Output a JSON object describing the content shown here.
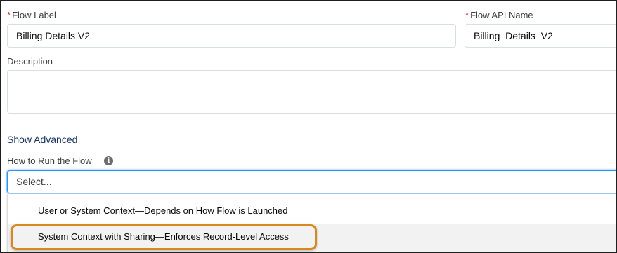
{
  "form": {
    "required_marker": "*",
    "flow_label": {
      "label": "Flow Label",
      "value": "Billing Details V2"
    },
    "flow_api_name": {
      "label": "Flow API Name",
      "value": "Billing_Details_V2"
    },
    "description": {
      "label": "Description",
      "value": ""
    },
    "show_advanced_label": "Show Advanced",
    "how_to_run": {
      "label": "How to Run the Flow",
      "info_icon": "info-icon",
      "placeholder": "Select...",
      "options": [
        {
          "label": "User or System Context—Depends on How Flow is Launched",
          "highlighted": false
        },
        {
          "label": "System Context with Sharing—Enforces Record-Level Access",
          "highlighted": true
        }
      ]
    }
  },
  "colors": {
    "required": "#c23934",
    "link": "#16325c",
    "focus_border": "#1b96ff",
    "callout_ring": "#d6891e",
    "option_highlight": "#f3f2f2"
  }
}
